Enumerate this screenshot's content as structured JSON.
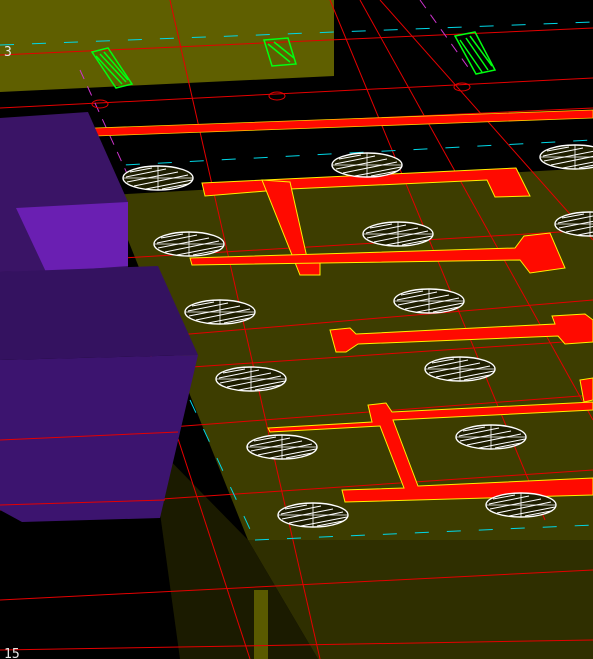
{
  "viewport": {
    "background": "#000000",
    "grid_labels": [
      "3",
      "15"
    ]
  },
  "colors": {
    "slab": "#3d3d00",
    "slab_top": "#5f5f00",
    "beam": "#ff0a00",
    "beam_outline": "#ffff00",
    "column": "#361264",
    "column_top": "#6a1fb2",
    "grid_line": "#e50000",
    "dashed_line": "#00d7e6",
    "rebar_hatch": "#ffffff",
    "label_green": "#00ff10",
    "magenta_line": "#cc33cc"
  },
  "icons": [
    "pile-cap-hatch-icon",
    "rebar-tag-icon",
    "grid-bubble-icon"
  ]
}
